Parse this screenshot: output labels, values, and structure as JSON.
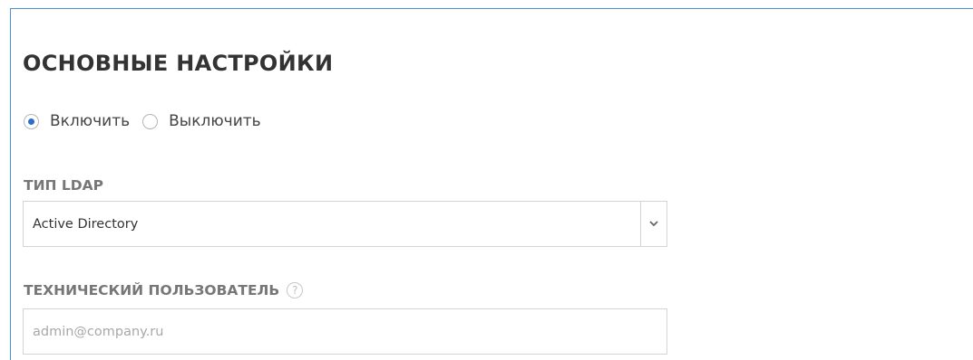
{
  "section": {
    "title": "ОСНОВНЫЕ НАСТРОЙКИ"
  },
  "status": {
    "options": [
      {
        "label": "Включить",
        "checked": true
      },
      {
        "label": "Выключить",
        "checked": false
      }
    ]
  },
  "ldap_type": {
    "label": "ТИП LDAP",
    "selected": "Active Directory",
    "icon": "chevron-down-icon"
  },
  "tech_user": {
    "label": "ТЕХНИЧЕСКИЙ ПОЛЬЗОВАТЕЛЬ",
    "help_icon": "question-circle-icon",
    "help_glyph": "?",
    "value": "",
    "placeholder": "admin@company.ru"
  },
  "colors": {
    "accent": "#2c6ecb",
    "frame_border": "#4a90d9",
    "title": "#333333",
    "label": "#777777"
  }
}
